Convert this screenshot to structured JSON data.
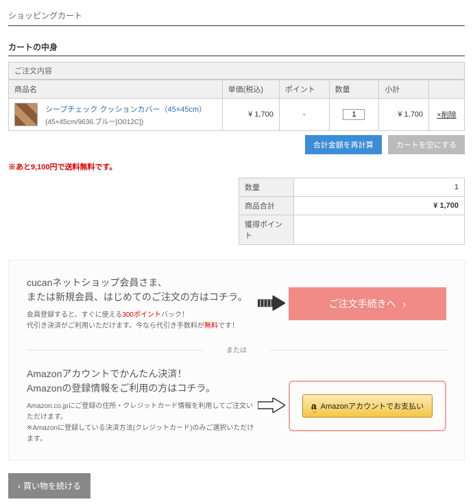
{
  "page_title": "ショッピングカート",
  "section_title": "カートの中身",
  "order_label": "ご注文内容",
  "headers": {
    "name": "商品名",
    "price": "単価(税込)",
    "point": "ポイント",
    "qty": "数量",
    "subtotal": "小計",
    "action": ""
  },
  "item": {
    "name": "シープチェック クッションカバー（45×45cm）",
    "variant": "(45×45cm/9636.ブルー[O012C])",
    "price": "¥ 1,700",
    "point": "-",
    "qty": "1",
    "subtotal": "¥ 1,700",
    "delete": "×削除"
  },
  "buttons": {
    "recalc": "合計金額を再計算",
    "empty": "カートを空にする"
  },
  "free_ship": "※あと9,100円で送料無料です。",
  "summary": {
    "qty_label": "数量",
    "qty_val": "1",
    "total_label": "商品合計",
    "total_val": "¥ 1,700",
    "point_label": "獲得ポイント",
    "point_val": ""
  },
  "checkout": {
    "member_h1": "cucanネットショップ会員さま、",
    "member_h2": "または新規会員、はじめてのご注文の方はコチラ。",
    "member_sub1a": "会員登録すると、すぐに使える",
    "member_sub1b": "300ポイント",
    "member_sub1c": "バック！",
    "member_sub2a": "代引き決済がご利用いただけます。今なら代引き手数料が",
    "member_sub2b": "無料",
    "member_sub2c": "です！",
    "proceed": "ご注文手続きへ",
    "divider": "または",
    "amazon_h1": "Amazonアカウントでかんたん決済！",
    "amazon_h2": "Amazonの登録情報をご利用の方はコチラ。",
    "amazon_sub1": "Amazon.co.jpにご登録の住所・クレジットカード情報を利用してご注文いただけます。",
    "amazon_sub2": "※Amazonに登録している決済方法(クレジットカード)のみご選択いただけます。",
    "amazon_btn": "Amazonアカウントでお支払い"
  },
  "continue": "買い物を続ける"
}
